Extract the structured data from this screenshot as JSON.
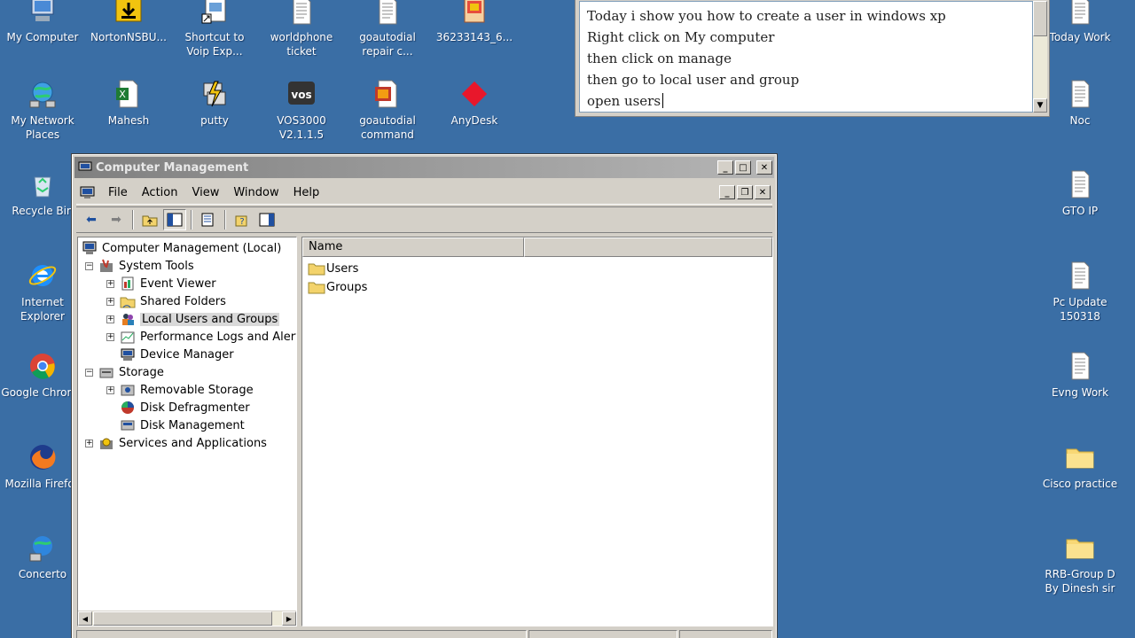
{
  "desktop_icons_left": [
    {
      "label": "My Computer",
      "icon": "my-computer-icon"
    },
    {
      "label": "NortonNSBU...",
      "icon": "download-icon"
    },
    {
      "label": "Shortcut to\nVoip Exp...",
      "icon": "shortcut-icon"
    },
    {
      "label": "worldphone\nticket",
      "icon": "text-file-icon"
    },
    {
      "label": "goautodial\nrepair c...",
      "icon": "text-file-icon"
    },
    {
      "label": "36233143_6...",
      "icon": "image-file-icon"
    },
    {
      "label": "My Network\nPlaces",
      "icon": "network-icon"
    },
    {
      "label": "Mahesh",
      "icon": "excel-file-icon"
    },
    {
      "label": "putty",
      "icon": "putty-icon"
    },
    {
      "label": "VOS3000\nV2.1.1.5",
      "icon": "vos-icon"
    },
    {
      "label": "goautodial\ncommand",
      "icon": "office-file-icon"
    },
    {
      "label": "AnyDesk",
      "icon": "anydesk-icon"
    },
    {
      "label": "Recycle Bin",
      "icon": "recycle-bin-icon"
    },
    {
      "label": "Internet\nExplorer",
      "icon": "ie-icon"
    },
    {
      "label": "Google Chrome",
      "icon": "chrome-icon"
    },
    {
      "label": "Mozilla Firefox",
      "icon": "firefox-icon"
    },
    {
      "label": "Concerto",
      "icon": "concerto-icon"
    }
  ],
  "desktop_icons_right": [
    {
      "label": "Today Work",
      "icon": "text-file-icon"
    },
    {
      "label": "Noc",
      "icon": "text-file-icon"
    },
    {
      "label": "GTO IP",
      "icon": "text-file-icon"
    },
    {
      "label": "Pc Update\n150318",
      "icon": "text-file-icon"
    },
    {
      "label": "Evng Work",
      "icon": "text-file-icon"
    },
    {
      "label": "Cisco practice",
      "icon": "folder-icon"
    },
    {
      "label": "RRB-Group D\nBy Dinesh sir",
      "icon": "folder-icon"
    }
  ],
  "note": {
    "lines": [
      "Today i show you how to create a user in windows xp",
      "Right click on My computer",
      "then click on manage",
      "then go to local user and group",
      "open users"
    ]
  },
  "window": {
    "title": "Computer Management",
    "menus": [
      "File",
      "Action",
      "View",
      "Window",
      "Help"
    ]
  },
  "tree": [
    {
      "label": "Computer Management (Local)",
      "level": 0,
      "expander": "",
      "icon": "computer-management-icon"
    },
    {
      "label": "System Tools",
      "level": 1,
      "expander": "−",
      "icon": "system-tools-icon"
    },
    {
      "label": "Event Viewer",
      "level": 2,
      "expander": "+",
      "icon": "event-viewer-icon"
    },
    {
      "label": "Shared Folders",
      "level": 2,
      "expander": "+",
      "icon": "shared-folders-icon"
    },
    {
      "label": "Local Users and Groups",
      "level": 2,
      "expander": "+",
      "icon": "users-icon",
      "selected": true
    },
    {
      "label": "Performance Logs and Alerts",
      "level": 2,
      "expander": "+",
      "icon": "performance-icon"
    },
    {
      "label": "Device Manager",
      "level": 2,
      "expander": "",
      "icon": "device-manager-icon"
    },
    {
      "label": "Storage",
      "level": 1,
      "expander": "−",
      "icon": "storage-icon"
    },
    {
      "label": "Removable Storage",
      "level": 2,
      "expander": "+",
      "icon": "removable-storage-icon"
    },
    {
      "label": "Disk Defragmenter",
      "level": 2,
      "expander": "",
      "icon": "defrag-icon"
    },
    {
      "label": "Disk Management",
      "level": 2,
      "expander": "",
      "icon": "disk-management-icon"
    },
    {
      "label": "Services and Applications",
      "level": 1,
      "expander": "+",
      "icon": "services-icon"
    }
  ],
  "list": {
    "column_name": "Name",
    "items": [
      "Users",
      "Groups"
    ]
  },
  "colors": {
    "desktop": "#3a6ea5",
    "chrome": "#d4d0c8",
    "inactive_title": "#808080"
  }
}
